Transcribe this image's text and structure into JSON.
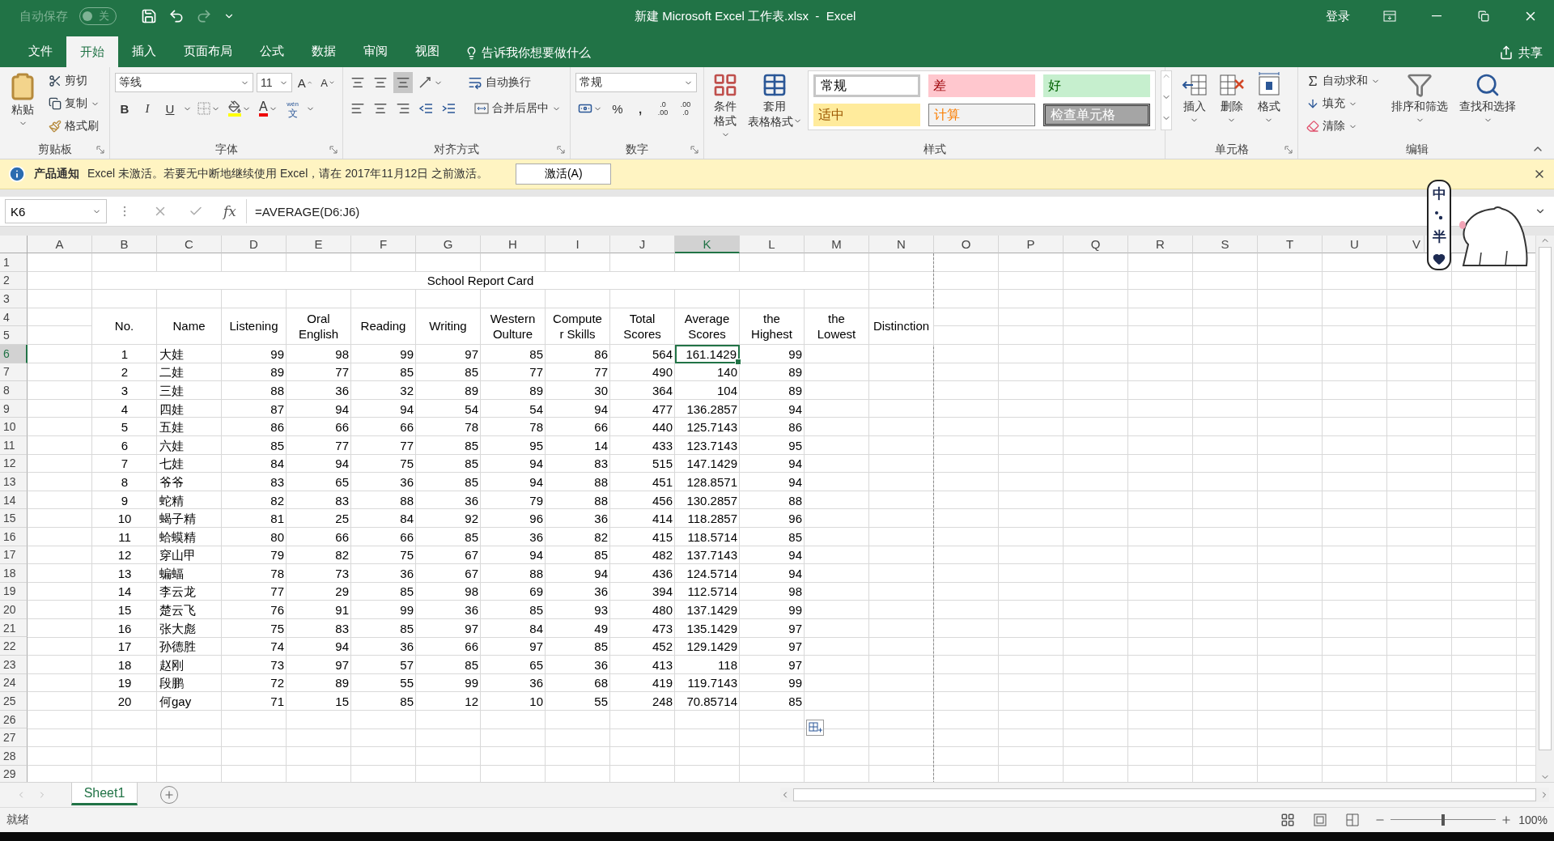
{
  "title_bar": {
    "autosave_label": "自动保存",
    "autosave_state": "关",
    "autosave_on": false,
    "title": "新建 Microsoft Excel 工作表.xlsx  -  Excel",
    "sign_in": "登录"
  },
  "ribbon_tabs": [
    {
      "label": "文件",
      "selected": false
    },
    {
      "label": "开始",
      "selected": true
    },
    {
      "label": "插入",
      "selected": false
    },
    {
      "label": "页面布局",
      "selected": false
    },
    {
      "label": "公式",
      "selected": false
    },
    {
      "label": "数据",
      "selected": false
    },
    {
      "label": "审阅",
      "selected": false
    },
    {
      "label": "视图",
      "selected": false
    }
  ],
  "tell_me": "告诉我你想要做什么",
  "share": "共享",
  "ribbon": {
    "clipboard": {
      "label": "剪贴板",
      "paste": "粘贴",
      "cut": "剪切",
      "copy": "复制",
      "format_painter": "格式刷"
    },
    "font": {
      "label": "字体",
      "font_name": "等线",
      "font_size": "11",
      "grow": "A",
      "shrink": "A",
      "bold": "B",
      "italic": "I",
      "underline": "U",
      "font_color": "A",
      "phonetic_top": "wén",
      "phonetic_char": "文"
    },
    "alignment": {
      "label": "对齐方式",
      "wrap": "自动换行",
      "merge": "合并后居中"
    },
    "number": {
      "label": "数字",
      "format": "常规",
      "percent": "%",
      "comma": ",",
      "increase_decimal_top": ".0",
      "increase_decimal_bottom": ".00",
      "decrease_decimal_top": ".00",
      "decrease_decimal_bottom": ".0"
    },
    "styles": {
      "label": "样式",
      "conditional": "条件格式",
      "table_format_1": "套用",
      "table_format_2": "表格格式",
      "gallery": [
        {
          "label": "常规",
          "kind": "normal"
        },
        {
          "label": "差",
          "kind": "bad"
        },
        {
          "label": "好",
          "kind": "good"
        },
        {
          "label": "适中",
          "kind": "neutral"
        },
        {
          "label": "计算",
          "kind": "calc"
        },
        {
          "label": "检查单元格",
          "kind": "check"
        }
      ]
    },
    "cells": {
      "label": "单元格",
      "insert": "插入",
      "delete": "删除",
      "format": "格式"
    },
    "editing": {
      "label": "编辑",
      "autosum": "自动求和",
      "fill": "填充",
      "clear": "清除",
      "sort": "排序和筛选",
      "find": "查找和选择"
    }
  },
  "notice": {
    "title": "产品通知",
    "message": "Excel 未激活。若要无中断地继续使用 Excel，请在 2017年11月12日 之前激活。",
    "button": "激活(A)"
  },
  "ime": {
    "mode": "中",
    "width": "半"
  },
  "formula_bar": {
    "name_box": "K6",
    "fx": "fx",
    "formula": "=AVERAGE(D6:J6)"
  },
  "columns": [
    {
      "label": "A",
      "selected": false
    },
    {
      "label": "B",
      "selected": false
    },
    {
      "label": "C",
      "selected": false
    },
    {
      "label": "D",
      "selected": false
    },
    {
      "label": "E",
      "selected": false
    },
    {
      "label": "F",
      "selected": false
    },
    {
      "label": "G",
      "selected": false
    },
    {
      "label": "H",
      "selected": false
    },
    {
      "label": "I",
      "selected": false
    },
    {
      "label": "J",
      "selected": false
    },
    {
      "label": "K",
      "selected": true
    },
    {
      "label": "L",
      "selected": false
    },
    {
      "label": "M",
      "selected": false
    },
    {
      "label": "N",
      "selected": false
    },
    {
      "label": "O",
      "selected": false
    },
    {
      "label": "P",
      "selected": false
    },
    {
      "label": "Q",
      "selected": false
    },
    {
      "label": "R",
      "selected": false
    },
    {
      "label": "S",
      "selected": false
    },
    {
      "label": "T",
      "selected": false
    },
    {
      "label": "U",
      "selected": false
    },
    {
      "label": "V",
      "selected": false
    }
  ],
  "row_headers": [
    {
      "label": "1",
      "selected": false
    },
    {
      "label": "2",
      "selected": false
    },
    {
      "label": "3",
      "selected": false
    },
    {
      "label": "4",
      "selected": false
    },
    {
      "label": "5",
      "selected": false
    },
    {
      "label": "6",
      "selected": true
    },
    {
      "label": "7",
      "selected": false
    },
    {
      "label": "8",
      "selected": false
    },
    {
      "label": "9",
      "selected": false
    },
    {
      "label": "10",
      "selected": false
    },
    {
      "label": "11",
      "selected": false
    },
    {
      "label": "12",
      "selected": false
    },
    {
      "label": "13",
      "selected": false
    },
    {
      "label": "14",
      "selected": false
    },
    {
      "label": "15",
      "selected": false
    },
    {
      "label": "16",
      "selected": false
    },
    {
      "label": "17",
      "selected": false
    },
    {
      "label": "18",
      "selected": false
    },
    {
      "label": "19",
      "selected": false
    },
    {
      "label": "20",
      "selected": false
    },
    {
      "label": "21",
      "selected": false
    },
    {
      "label": "22",
      "selected": false
    },
    {
      "label": "23",
      "selected": false
    },
    {
      "label": "24",
      "selected": false
    },
    {
      "label": "25",
      "selected": false
    },
    {
      "label": "26",
      "selected": false
    },
    {
      "label": "27",
      "selected": false
    },
    {
      "label": "28",
      "selected": false
    },
    {
      "label": "29",
      "selected": false
    }
  ],
  "report": {
    "title": "School Report Card",
    "headers": [
      [
        "No."
      ],
      [
        "Name"
      ],
      [
        "Listening"
      ],
      [
        "Oral",
        "English"
      ],
      [
        "Reading"
      ],
      [
        "Writing"
      ],
      [
        "Western",
        "Oulture"
      ],
      [
        "Compute",
        "r Skills"
      ],
      [
        "Total",
        "Scores"
      ],
      [
        "Average",
        "Scores"
      ],
      [
        "the",
        "Highest"
      ],
      [
        "the",
        "Lowest"
      ],
      [
        "Distinction"
      ]
    ],
    "rows": [
      [
        "1",
        "大娃",
        "99",
        "98",
        "99",
        "97",
        "85",
        "86",
        "564",
        "161.1429",
        "99"
      ],
      [
        "2",
        "二娃",
        "89",
        "77",
        "85",
        "85",
        "77",
        "77",
        "490",
        "140",
        "89"
      ],
      [
        "3",
        "三娃",
        "88",
        "36",
        "32",
        "89",
        "89",
        "30",
        "364",
        "104",
        "89"
      ],
      [
        "4",
        "四娃",
        "87",
        "94",
        "94",
        "54",
        "54",
        "94",
        "477",
        "136.2857",
        "94"
      ],
      [
        "5",
        "五娃",
        "86",
        "66",
        "66",
        "78",
        "78",
        "66",
        "440",
        "125.7143",
        "86"
      ],
      [
        "6",
        "六娃",
        "85",
        "77",
        "77",
        "85",
        "95",
        "14",
        "433",
        "123.7143",
        "95"
      ],
      [
        "7",
        "七娃",
        "84",
        "94",
        "75",
        "85",
        "94",
        "83",
        "515",
        "147.1429",
        "94"
      ],
      [
        "8",
        "爷爷",
        "83",
        "65",
        "36",
        "85",
        "94",
        "88",
        "451",
        "128.8571",
        "94"
      ],
      [
        "9",
        "蛇精",
        "82",
        "83",
        "88",
        "36",
        "79",
        "88",
        "456",
        "130.2857",
        "88"
      ],
      [
        "10",
        "蝎子精",
        "81",
        "25",
        "84",
        "92",
        "96",
        "36",
        "414",
        "118.2857",
        "96"
      ],
      [
        "11",
        "蛤蟆精",
        "80",
        "66",
        "66",
        "85",
        "36",
        "82",
        "415",
        "118.5714",
        "85"
      ],
      [
        "12",
        "穿山甲",
        "79",
        "82",
        "75",
        "67",
        "94",
        "85",
        "482",
        "137.7143",
        "94"
      ],
      [
        "13",
        "蝙蝠",
        "78",
        "73",
        "36",
        "67",
        "88",
        "94",
        "436",
        "124.5714",
        "94"
      ],
      [
        "14",
        "李云龙",
        "77",
        "29",
        "85",
        "98",
        "69",
        "36",
        "394",
        "112.5714",
        "98"
      ],
      [
        "15",
        "楚云飞",
        "76",
        "91",
        "99",
        "36",
        "85",
        "93",
        "480",
        "137.1429",
        "99"
      ],
      [
        "16",
        "张大彪",
        "75",
        "83",
        "85",
        "97",
        "84",
        "49",
        "473",
        "135.1429",
        "97"
      ],
      [
        "17",
        "孙德胜",
        "74",
        "94",
        "36",
        "66",
        "97",
        "85",
        "452",
        "129.1429",
        "97"
      ],
      [
        "18",
        "赵刚",
        "73",
        "97",
        "57",
        "85",
        "65",
        "36",
        "413",
        "118",
        "97"
      ],
      [
        "19",
        "段鹏",
        "72",
        "89",
        "55",
        "99",
        "36",
        "68",
        "419",
        "119.7143",
        "99"
      ],
      [
        "20",
        "何gay",
        "71",
        "15",
        "85",
        "12",
        "10",
        "55",
        "248",
        "70.85714",
        "85"
      ]
    ]
  },
  "sheet_tabs": [
    {
      "label": "Sheet1",
      "selected": true
    }
  ],
  "status_bar": {
    "status": "就绪",
    "zoom": "100%",
    "zoom_slider": {
      "level": 0.5
    }
  }
}
